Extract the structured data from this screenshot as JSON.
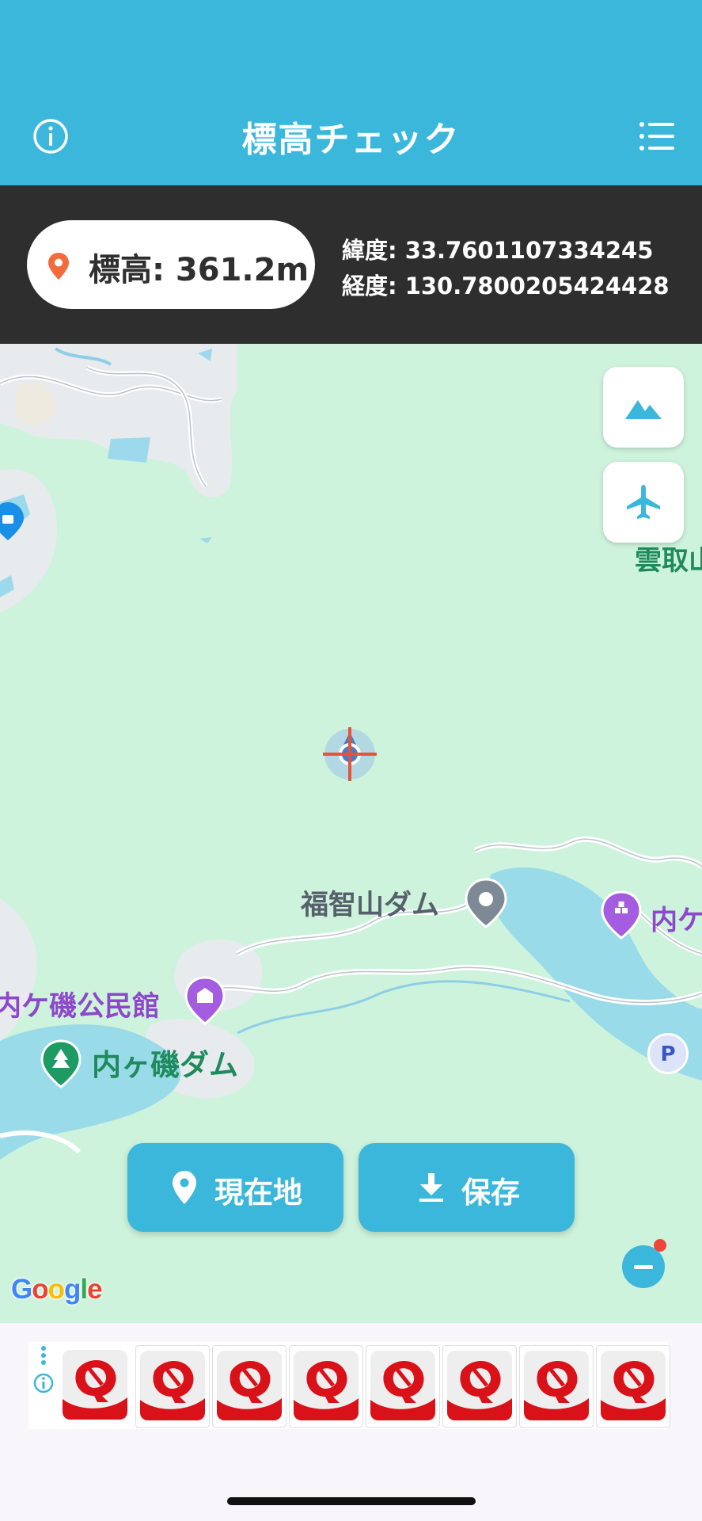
{
  "header": {
    "title": "標高チェック",
    "info_icon": "info-circle-icon",
    "menu_icon": "list-icon",
    "color": "#3cb7dc"
  },
  "status": {
    "elevation_label": "標高: 361.2m",
    "latitude_label": "緯度: 33.7601107334245",
    "longitude_label": "経度: 130.7800205424428",
    "pin_color": "#f26b3a"
  },
  "map": {
    "labels": {
      "fukuchiyama_dam": "福智山ダム",
      "uchigaiso_dam": "内ヶ磯ダム",
      "uchigaiso_hall": "内ケ磯公民館",
      "uchiga_partial": "内ケ",
      "kumotori_partial": "雲取山",
      "parking": "P"
    },
    "side_buttons": [
      {
        "name": "terrain",
        "icon": "mountain-icon"
      },
      {
        "name": "flight",
        "icon": "airplane-icon"
      }
    ],
    "google_logo": "Google"
  },
  "actions": {
    "current_location": "現在地",
    "save": "保存"
  },
  "ads": {
    "tile_count": 8,
    "icon": "ad-app-logo-icon"
  }
}
